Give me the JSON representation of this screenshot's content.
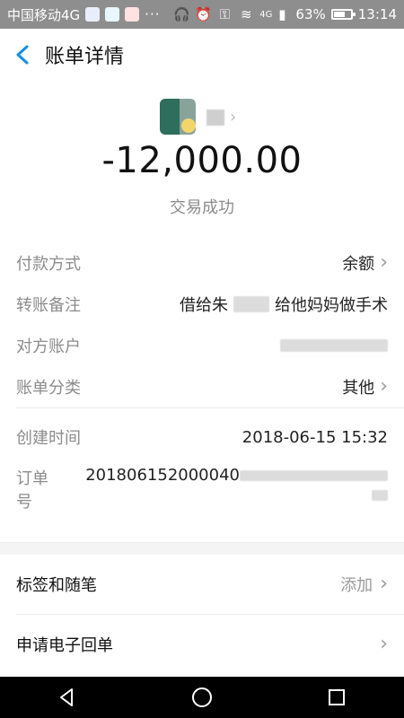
{
  "status_bar": {
    "carrier": "中国移动4G",
    "dots": "···",
    "signal_text": "4G",
    "battery": "63%",
    "time": "13:14",
    "bg_color": "#8e8e8e"
  },
  "header": {
    "title": "账单详情",
    "accent_color": "#108ee9",
    "back_icon": "chevron-left-icon"
  },
  "summary": {
    "amount": "-12,000.00",
    "status": "交易成功"
  },
  "details": {
    "payment_method_label": "付款方式",
    "payment_method_value": "余额",
    "remark_label": "转账备注",
    "remark_prefix": "借给朱",
    "remark_suffix": "给他妈妈做手术",
    "counterparty_label": "对方账户",
    "category_label": "账单分类",
    "category_value": "其他",
    "created_time_label": "创建时间",
    "created_time_value": "2018-06-15 15:32",
    "order_no_label": "订单号",
    "order_no_value": "201806152000040"
  },
  "actions": {
    "tags_label": "标签和随笔",
    "tags_action": "添加",
    "receipt_label": "申请电子回单"
  }
}
